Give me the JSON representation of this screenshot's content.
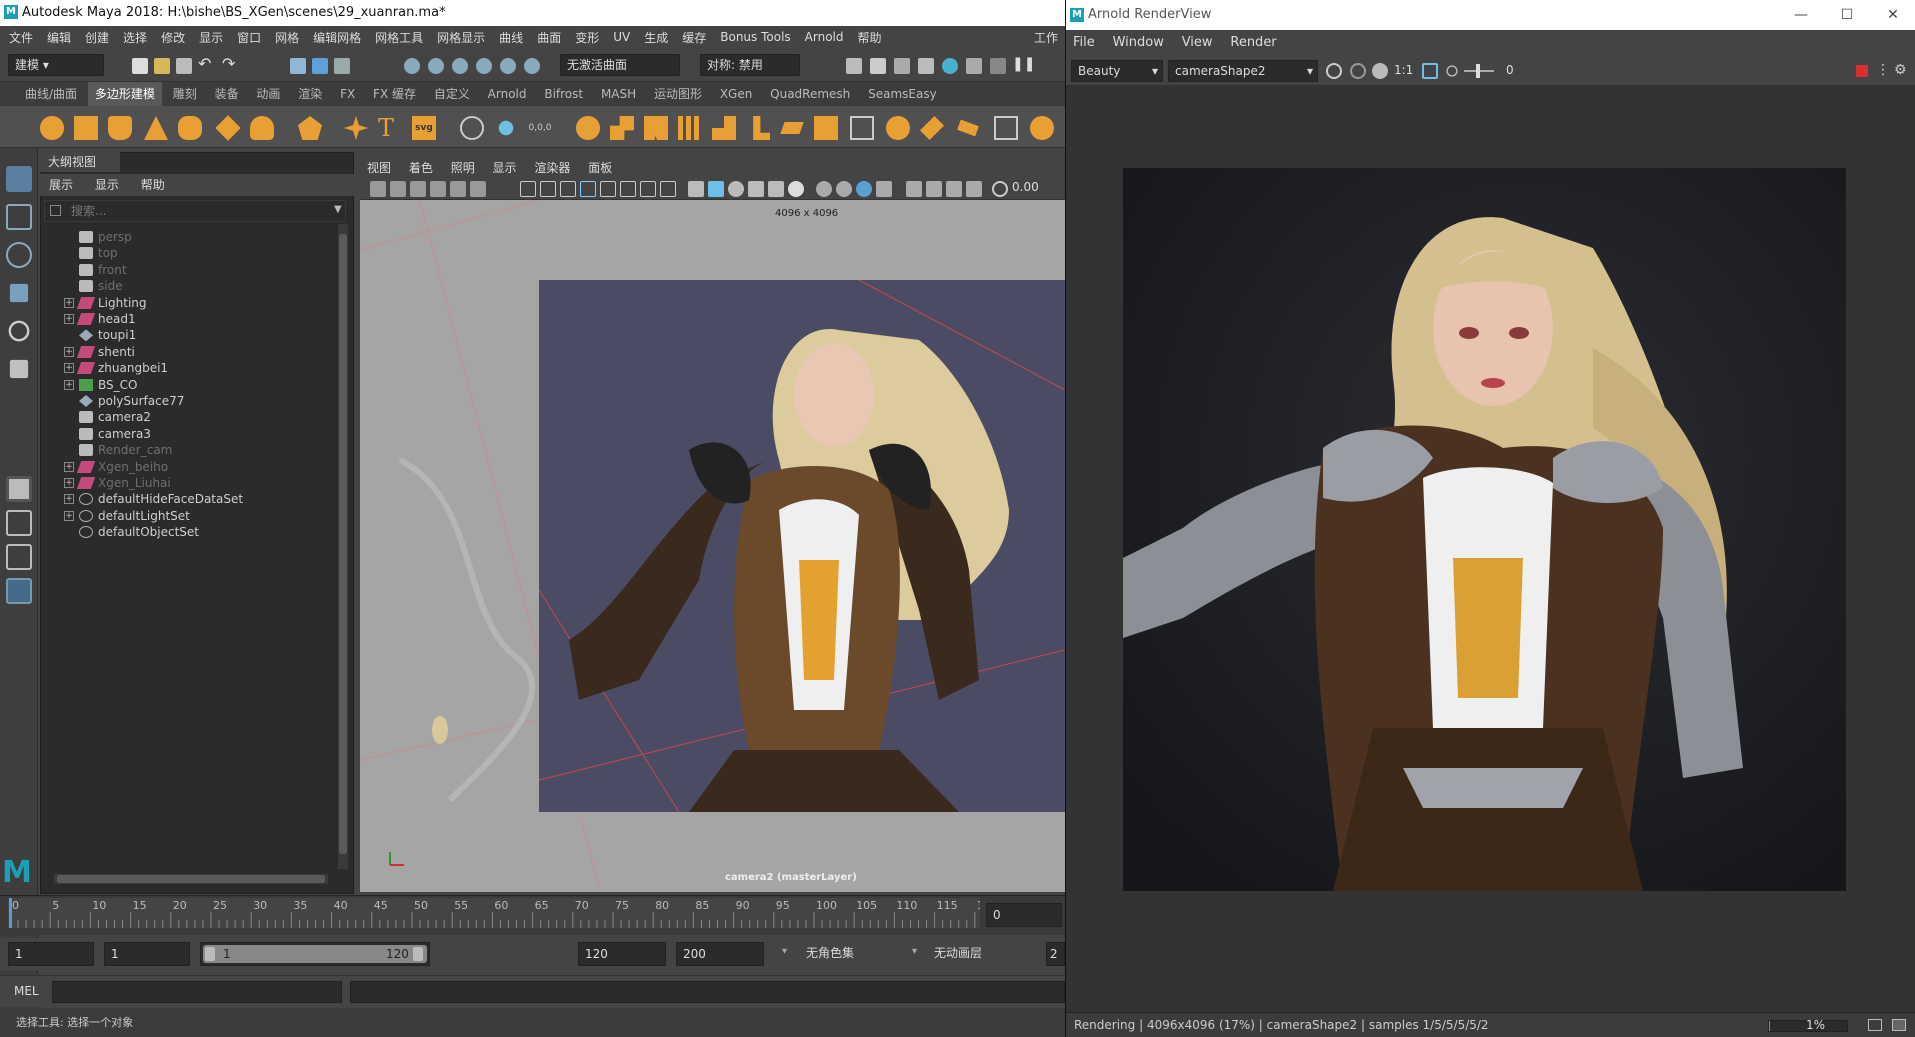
{
  "maya": {
    "title": "Autodesk Maya 2018: H:\\bishe\\BS_XGen\\scenes\\29_xuanran.ma*",
    "menus": [
      "文件",
      "编辑",
      "创建",
      "选择",
      "修改",
      "显示",
      "窗口",
      "网格",
      "编辑网格",
      "网格工具",
      "网格显示",
      "曲线",
      "曲面",
      "变形",
      "UV",
      "生成",
      "缓存",
      "Bonus Tools",
      "Arnold",
      "帮助"
    ],
    "workspace_label": "工作",
    "mode_menu": "建模",
    "live_surface": "无激活曲面",
    "symmetry": "对称: 禁用",
    "shelf_tabs": [
      "曲线/曲面",
      "多边形建模",
      "雕刻",
      "装备",
      "动画",
      "渲染",
      "FX",
      "FX 缓存",
      "自定义",
      "Arnold",
      "Bifrost",
      "MASH",
      "运动图形",
      "XGen",
      "QuadRemesh",
      "SeamsEasy"
    ],
    "shelf_active_tab": "多边形建模",
    "shelf_text_icon": "T",
    "shelf_svg_icon": "svg",
    "outliner": {
      "tab": "大纲视图",
      "menus": [
        "展示",
        "显示",
        "帮助"
      ],
      "search_placeholder": "搜索...",
      "items": [
        {
          "label": "persp",
          "icon": "camera-icon",
          "dim": true,
          "expandable": false
        },
        {
          "label": "top",
          "icon": "camera-icon",
          "dim": true,
          "expandable": false
        },
        {
          "label": "front",
          "icon": "camera-icon",
          "dim": true,
          "expandable": false
        },
        {
          "label": "side",
          "icon": "camera-icon",
          "dim": true,
          "expandable": false
        },
        {
          "label": "Lighting",
          "icon": "group-icon",
          "dim": false,
          "expandable": true
        },
        {
          "label": "head1",
          "icon": "group-icon",
          "dim": false,
          "expandable": true
        },
        {
          "label": "toupi1",
          "icon": "mesh-icon",
          "dim": false,
          "expandable": false
        },
        {
          "label": "shenti",
          "icon": "group-icon",
          "dim": false,
          "expandable": true
        },
        {
          "label": "zhuangbei1",
          "icon": "group-icon",
          "dim": false,
          "expandable": true
        },
        {
          "label": "BS_CO",
          "icon": "blendshape-icon",
          "dim": false,
          "expandable": true
        },
        {
          "label": "polySurface77",
          "icon": "mesh-icon",
          "dim": false,
          "expandable": false
        },
        {
          "label": "camera2",
          "icon": "camera-icon",
          "dim": false,
          "expandable": false
        },
        {
          "label": "camera3",
          "icon": "camera-icon",
          "dim": false,
          "expandable": false
        },
        {
          "label": "Render_cam",
          "icon": "camera-icon",
          "dim": true,
          "expandable": false
        },
        {
          "label": "Xgen_beiho",
          "icon": "group-icon",
          "dim": true,
          "expandable": true
        },
        {
          "label": "Xgen_Liuhai",
          "icon": "group-icon",
          "dim": true,
          "expandable": true
        },
        {
          "label": "defaultHideFaceDataSet",
          "icon": "set-icon",
          "dim": false,
          "expandable": true
        },
        {
          "label": "defaultLightSet",
          "icon": "set-icon",
          "dim": false,
          "expandable": true
        },
        {
          "label": "defaultObjectSet",
          "icon": "set-icon",
          "dim": false,
          "expandable": false
        }
      ]
    },
    "viewport": {
      "menus": [
        "视图",
        "着色",
        "照明",
        "显示",
        "渲染器",
        "面板"
      ],
      "value_field": "0.00",
      "resolution": "4096 x 4096",
      "camera_label": "camera2 (masterLayer)"
    },
    "timeline": {
      "ticks": [
        "0",
        "5",
        "10",
        "15",
        "20",
        "25",
        "30",
        "35",
        "40",
        "45",
        "50",
        "55",
        "60",
        "65",
        "70",
        "75",
        "80",
        "85",
        "90",
        "95",
        "100",
        "105",
        "110",
        "115",
        "12"
      ],
      "current_frame": "0"
    },
    "range": {
      "start": "1",
      "playback_start": "1",
      "slider_start": "1",
      "slider_end": "120",
      "playback_end": "120",
      "end": "200",
      "character_set": "无角色集",
      "anim_layer": "无动画层",
      "fps_stub": "2"
    },
    "mel_label": "MEL",
    "help_line": "选择工具: 选择一个对象"
  },
  "arnold": {
    "title": "Arnold RenderView",
    "menus": [
      "File",
      "Window",
      "View",
      "Render"
    ],
    "aov": "Beauty",
    "camera": "cameraShape2",
    "ratio": "1:1",
    "exposure": "0",
    "status": "Rendering | 4096x4096 (17%) | cameraShape2 | samples 1/5/5/5/5/2",
    "progress_label": "1%",
    "progress": 0.01
  },
  "colors": {
    "maya_blue": "#1a9fb5",
    "shelf_orange": "#e8a035",
    "stop_red": "#d9302f"
  }
}
